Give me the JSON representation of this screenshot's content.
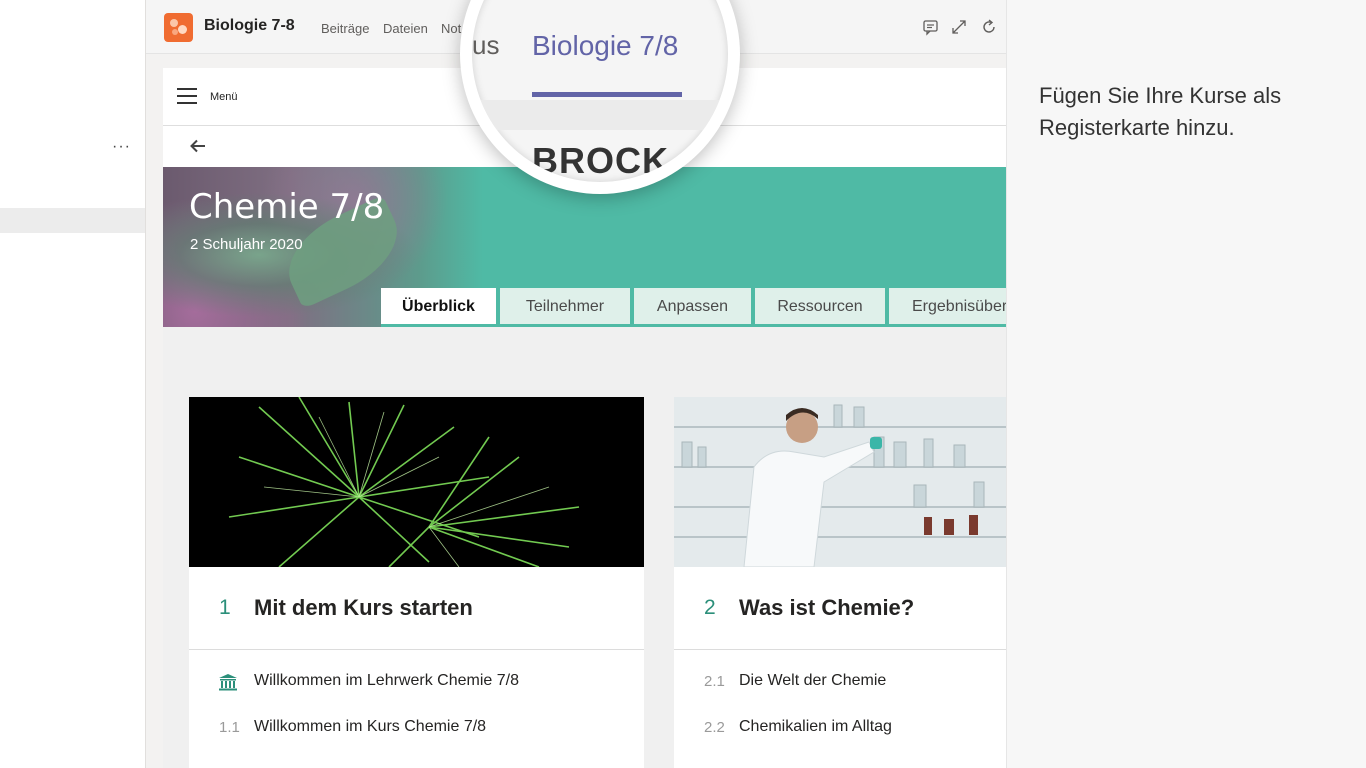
{
  "sidebar": {
    "more_label": "···"
  },
  "header": {
    "team_name": "Biologie 7-8",
    "tabs": [
      "Beiträge",
      "Dateien",
      "Not"
    ],
    "icons": [
      "chat-icon",
      "expand-icon",
      "refresh-icon"
    ]
  },
  "magnifier": {
    "prev_tab_fragment": "us",
    "active_tab": "Biologie 7/8",
    "brand_fragment": "BROCK",
    "accent": "#6264a7"
  },
  "app": {
    "menu_label": "Menü",
    "course": {
      "title": "Chemie 7/8",
      "subtitle": "2 Schuljahr 2020",
      "accent": "#4fbaa5"
    },
    "tabs": [
      "Überblick",
      "Teilnehmer",
      "Anpassen",
      "Ressourcen",
      "Ergebnisüber"
    ],
    "active_tab_index": 0,
    "chapters": [
      {
        "number": "1",
        "title": "Mit dem Kurs starten",
        "image": "fireworks-image",
        "lessons": [
          {
            "number": "",
            "icon": "institution-icon",
            "title": "Willkommen im Lehrwerk Chemie 7/8"
          },
          {
            "number": "1.1",
            "title": "Willkommen im Kurs Chemie 7/8"
          }
        ]
      },
      {
        "number": "2",
        "title": "Was ist Chemie?",
        "image": "laboratory-image",
        "lessons": [
          {
            "number": "2.1",
            "title": "Die Welt der Chemie"
          },
          {
            "number": "2.2",
            "title": "Chemikalien im Alltag"
          }
        ]
      }
    ]
  },
  "right_panel": {
    "text": "Fügen Sie Ihre Kurse als Registerkarte hinzu."
  }
}
